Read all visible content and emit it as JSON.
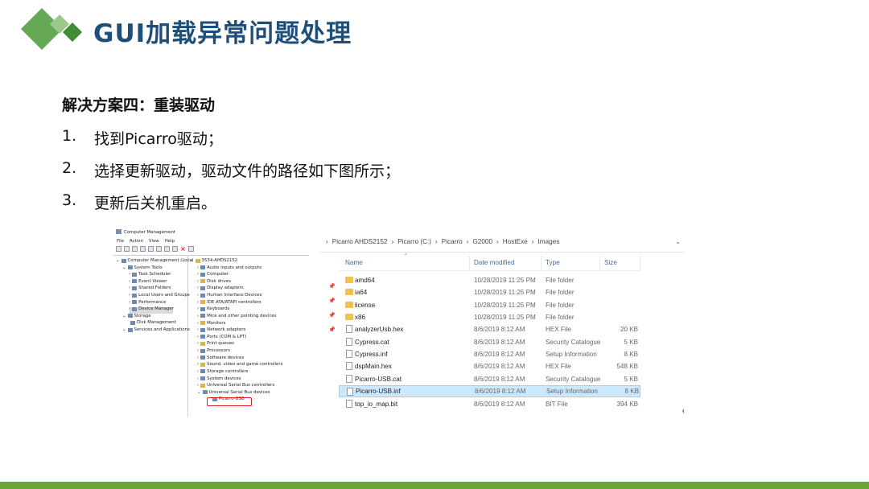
{
  "slide": {
    "title": "GUI加载异常问题处理",
    "heading": "解决方案四：重装驱动",
    "steps": [
      {
        "num": "1.",
        "text": "找到Picarro驱动；"
      },
      {
        "num": "2.",
        "text": "选择更新驱动，驱动文件的路径如下图所示；"
      },
      {
        "num": "3.",
        "text": "更新后关机重启。"
      }
    ],
    "colors": {
      "title": "#1f4e79",
      "logo_green": "#4a9a3a",
      "bottom_bar": "#6aa533"
    }
  },
  "computer_management": {
    "window_title": "Computer Management",
    "menu": [
      "File",
      "Action",
      "View",
      "Help"
    ],
    "left_tree": [
      {
        "label": "Computer Management (Local",
        "indent": 0
      },
      {
        "label": "System Tools",
        "indent": 1
      },
      {
        "label": "Task Scheduler",
        "indent": 2
      },
      {
        "label": "Event Viewer",
        "indent": 2
      },
      {
        "label": "Shared Folders",
        "indent": 2
      },
      {
        "label": "Local Users and Groups",
        "indent": 2
      },
      {
        "label": "Performance",
        "indent": 2
      },
      {
        "label": "Device Manager",
        "indent": 2,
        "selected": true
      },
      {
        "label": "Storage",
        "indent": 1
      },
      {
        "label": "Disk Management",
        "indent": 2
      },
      {
        "label": "Services and Applications",
        "indent": 1
      }
    ],
    "device_tree": [
      "3534-AHDS2152",
      "Audio inputs and outputs",
      "Computer",
      "Disk drives",
      "Display adapters",
      "Human Interface Devices",
      "IDE ATA/ATAPI controllers",
      "Keyboards",
      "Mice and other pointing devices",
      "Monitors",
      "Network adapters",
      "Ports (COM & LPT)",
      "Print queues",
      "Processors",
      "Software devices",
      "Sound, video and game controllers",
      "Storage controllers",
      "System devices",
      "Universal Serial Bus controllers",
      "Universal Serial Bus devices",
      "Picarro-USB"
    ]
  },
  "explorer": {
    "breadcrumb": [
      "Picarro AHDS2152",
      "Picarro (C:)",
      "Picarro",
      "G2000",
      "HostExe",
      "Images"
    ],
    "columns": {
      "name": "Name",
      "date": "Date modified",
      "type": "Type",
      "size": "Size"
    },
    "rows": [
      {
        "name": "amd64",
        "date": "10/28/2019 11:25 PM",
        "type": "File folder",
        "size": "",
        "kind": "folder"
      },
      {
        "name": "ia64",
        "date": "10/28/2019 11:25 PM",
        "type": "File folder",
        "size": "",
        "kind": "folder"
      },
      {
        "name": "license",
        "date": "10/28/2019 11:25 PM",
        "type": "File folder",
        "size": "",
        "kind": "folder"
      },
      {
        "name": "x86",
        "date": "10/28/2019 11:25 PM",
        "type": "File folder",
        "size": "",
        "kind": "folder"
      },
      {
        "name": "analyzerUsb.hex",
        "date": "8/6/2019 8:12 AM",
        "type": "HEX File",
        "size": "20 KB",
        "kind": "file"
      },
      {
        "name": "Cypress.cat",
        "date": "8/6/2019 8:12 AM",
        "type": "Security Catalogue",
        "size": "5 KB",
        "kind": "file"
      },
      {
        "name": "Cypress.inf",
        "date": "8/6/2019 8:12 AM",
        "type": "Setup Information",
        "size": "8 KB",
        "kind": "file"
      },
      {
        "name": "dspMain.hex",
        "date": "8/6/2019 8:12 AM",
        "type": "HEX File",
        "size": "548 KB",
        "kind": "file"
      },
      {
        "name": "Picarro-USB.cat",
        "date": "8/6/2019 8:12 AM",
        "type": "Security Catalogue",
        "size": "5 KB",
        "kind": "file"
      },
      {
        "name": "Picarro-USB.inf",
        "date": "8/6/2019 8:12 AM",
        "type": "Setup Information",
        "size": "8 KB",
        "kind": "file",
        "selected": true
      },
      {
        "name": "top_io_map.bit",
        "date": "8/6/2019 8:12 AM",
        "type": "BIT File",
        "size": "394 KB",
        "kind": "file"
      }
    ]
  }
}
